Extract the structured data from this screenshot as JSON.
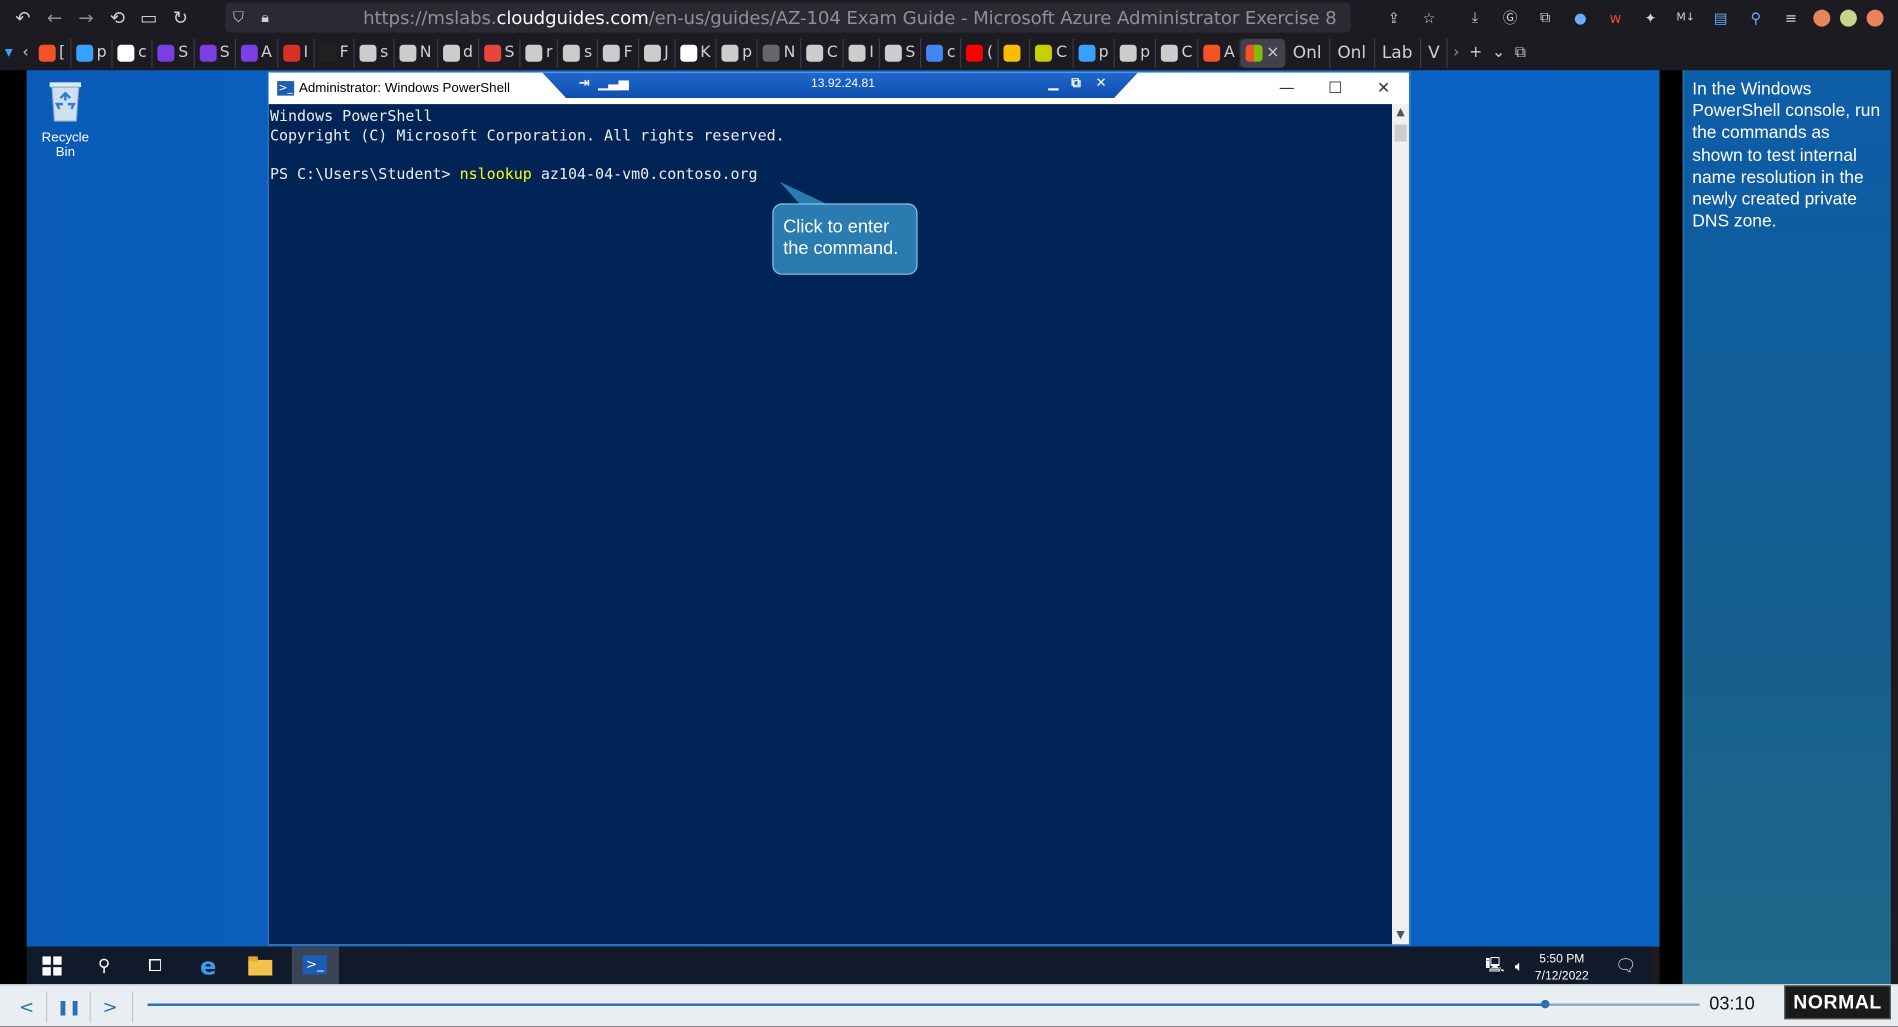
{
  "browser": {
    "url_prefix": "https://mslabs.",
    "url_domain": "cloudguides.com",
    "url_path": "/en-us/guides/AZ-104 Exam Guide - Microsoft Azure Administrator Exercise 8",
    "tabs": [
      {
        "label": "[",
        "color": "#f35325"
      },
      {
        "label": "p",
        "color": "#3aa0ff"
      },
      {
        "label": "c",
        "color": "#ffffff"
      },
      {
        "label": "S",
        "color": "#7b3fe4"
      },
      {
        "label": "S",
        "color": "#7b3fe4"
      },
      {
        "label": "A",
        "color": "#7b3fe4"
      },
      {
        "label": "I",
        "color": "#d93025"
      },
      {
        "label": "F",
        "color": "#222222"
      },
      {
        "label": "s",
        "color": "#cccccc"
      },
      {
        "label": "N",
        "color": "#cccccc"
      },
      {
        "label": "d",
        "color": "#cccccc"
      },
      {
        "label": "S",
        "color": "#e8453c"
      },
      {
        "label": "r",
        "color": "#cccccc"
      },
      {
        "label": "s",
        "color": "#cccccc"
      },
      {
        "label": "F",
        "color": "#cccccc"
      },
      {
        "label": "J",
        "color": "#cccccc"
      },
      {
        "label": "K",
        "color": "#ffffff"
      },
      {
        "label": "p",
        "color": "#cccccc"
      },
      {
        "label": "N",
        "color": "#666666"
      },
      {
        "label": "C",
        "color": "#cccccc"
      },
      {
        "label": "I",
        "color": "#cccccc"
      },
      {
        "label": "S",
        "color": "#cccccc"
      },
      {
        "label": "c",
        "color": "#4285f4"
      },
      {
        "label": "(",
        "color": "#ff0000"
      },
      {
        "label": "",
        "color": "#fbbc05"
      },
      {
        "label": "C",
        "color": "#c6d000"
      },
      {
        "label": "p",
        "color": "#3aa0ff"
      },
      {
        "label": "p",
        "color": "#cccccc"
      },
      {
        "label": "C",
        "color": "#cccccc"
      },
      {
        "label": "A",
        "color": "#f35325"
      }
    ],
    "text_tabs": [
      "Onl",
      "Onl",
      "Lab",
      "V"
    ]
  },
  "powershell": {
    "window_title": "Administrator: Windows PowerShell",
    "rdp_ip": "13.92.24.81",
    "lines": {
      "header1": "Windows PowerShell",
      "header2": "Copyright (C) Microsoft Corporation. All rights reserved.",
      "prompt": "PS C:\\Users\\Student> ",
      "command": "nslookup",
      "args": " az104-04-vm0.contoso.org"
    }
  },
  "desktop": {
    "recycle_bin_label": "Recycle Bin"
  },
  "callout": {
    "line1": "Click to enter",
    "line2": "the command."
  },
  "taskbar": {
    "time": "5:50 PM",
    "date": "7/12/2022"
  },
  "guide": {
    "text": "In the Windows PowerShell console, run the commands as shown to test internal name resolution in the newly created private DNS zone."
  },
  "playback": {
    "time": "03:10",
    "mode": "NORMAL",
    "progress": 0.9
  }
}
